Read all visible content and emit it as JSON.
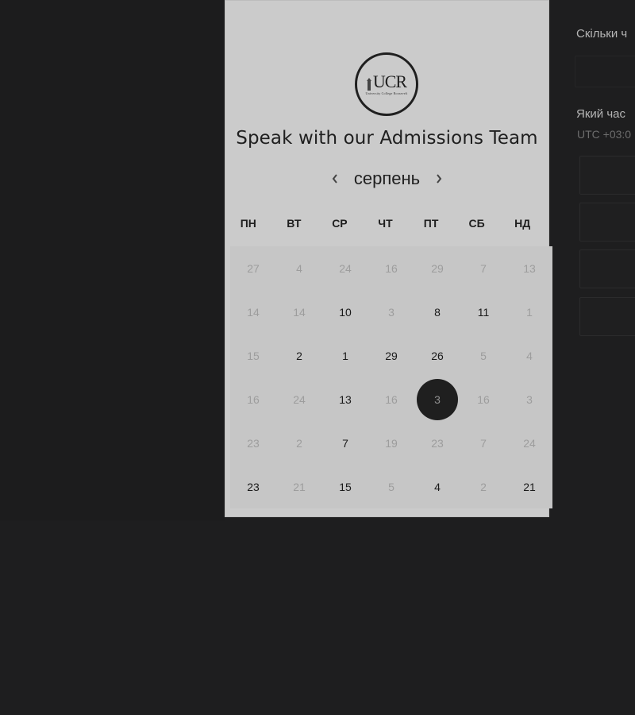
{
  "logo": {
    "mark": "UCR",
    "sub": "University College Roosevelt"
  },
  "calendar": {
    "title": "Speak with our Admissions Team",
    "month": "серпень",
    "weekdays": [
      "ПН",
      "ВТ",
      "СР",
      "ЧТ",
      "ПТ",
      "СБ",
      "НД"
    ],
    "weeks": [
      [
        {
          "d": "27",
          "s": "muted"
        },
        {
          "d": "4",
          "s": "muted"
        },
        {
          "d": "24",
          "s": "muted"
        },
        {
          "d": "16",
          "s": "muted"
        },
        {
          "d": "29",
          "s": "muted"
        },
        {
          "d": "7",
          "s": "muted"
        },
        {
          "d": "13",
          "s": "muted"
        }
      ],
      [
        {
          "d": "14",
          "s": "muted"
        },
        {
          "d": "14",
          "s": "muted"
        },
        {
          "d": "10",
          "s": "active"
        },
        {
          "d": "3",
          "s": "muted"
        },
        {
          "d": "8",
          "s": "active"
        },
        {
          "d": "11",
          "s": "active"
        },
        {
          "d": "1",
          "s": "muted"
        }
      ],
      [
        {
          "d": "15",
          "s": "muted"
        },
        {
          "d": "2",
          "s": "active"
        },
        {
          "d": "1",
          "s": "active"
        },
        {
          "d": "29",
          "s": "active"
        },
        {
          "d": "26",
          "s": "active"
        },
        {
          "d": "5",
          "s": "muted"
        },
        {
          "d": "4",
          "s": "muted"
        }
      ],
      [
        {
          "d": "16",
          "s": "muted"
        },
        {
          "d": "24",
          "s": "muted"
        },
        {
          "d": "13",
          "s": "active"
        },
        {
          "d": "16",
          "s": "muted"
        },
        {
          "d": "3",
          "s": "selected"
        },
        {
          "d": "16",
          "s": "muted"
        },
        {
          "d": "3",
          "s": "muted"
        }
      ],
      [
        {
          "d": "23",
          "s": "muted"
        },
        {
          "d": "2",
          "s": "muted"
        },
        {
          "d": "7",
          "s": "active"
        },
        {
          "d": "19",
          "s": "muted"
        },
        {
          "d": "23",
          "s": "muted"
        },
        {
          "d": "7",
          "s": "muted"
        },
        {
          "d": "24",
          "s": "muted"
        }
      ],
      [
        {
          "d": "23",
          "s": "active"
        },
        {
          "d": "21",
          "s": "muted"
        },
        {
          "d": "15",
          "s": "active"
        },
        {
          "d": "5",
          "s": "muted"
        },
        {
          "d": "4",
          "s": "active"
        },
        {
          "d": "2",
          "s": "muted"
        },
        {
          "d": "21",
          "s": "active"
        }
      ]
    ]
  },
  "right_panel": {
    "duration_label": "Скільки ч",
    "time_label": "Який час",
    "timezone": "UTC +03:0"
  }
}
